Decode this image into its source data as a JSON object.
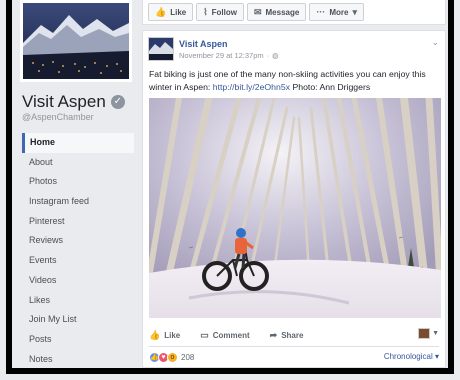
{
  "page": {
    "name": "Visit Aspen",
    "handle": "@AspenChamber"
  },
  "nav": {
    "items": [
      {
        "label": "Home",
        "active": true
      },
      {
        "label": "About"
      },
      {
        "label": "Photos"
      },
      {
        "label": "Instagram feed"
      },
      {
        "label": "Pinterest"
      },
      {
        "label": "Reviews"
      },
      {
        "label": "Events"
      },
      {
        "label": "Videos"
      },
      {
        "label": "Likes"
      },
      {
        "label": "Join My List"
      },
      {
        "label": "Posts"
      },
      {
        "label": "Notes"
      }
    ]
  },
  "topbar": {
    "like": "Like",
    "follow": "Follow",
    "message": "Message",
    "more": "More"
  },
  "post": {
    "author": "Visit Aspen",
    "date": "November 29 at 12:37pm",
    "text_before_link": "Fat biking is just one of the many non-skiing activities you can enjoy this winter in Aspen: ",
    "link": "http://bit.ly/2eOhn5x",
    "text_after_link": " Photo: Ann Driggers",
    "actions": {
      "like": "Like",
      "comment": "Comment",
      "share": "Share"
    },
    "reaction_count": "208",
    "sort": "Chronological"
  },
  "icons": {
    "verified": "verified-badge-icon",
    "globe": "globe-icon",
    "chevron": "chevron-down-icon"
  },
  "colors": {
    "link": "#365899",
    "accent": "#4267b2",
    "like_reaction": "#5890ff",
    "love_reaction": "#f25268",
    "wow_reaction": "#f7b125"
  }
}
